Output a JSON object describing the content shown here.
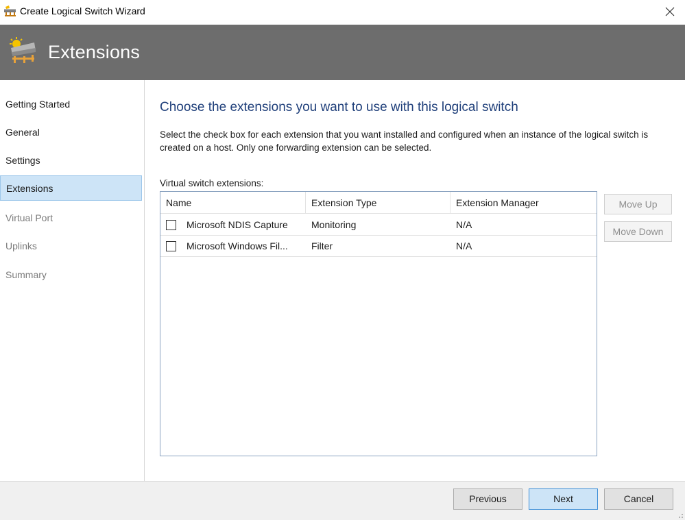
{
  "window": {
    "title": "Create Logical Switch Wizard",
    "close_icon": "close-icon"
  },
  "header": {
    "title": "Extensions",
    "icon": "logical-switch-icon"
  },
  "nav": {
    "items": [
      {
        "label": "Getting Started",
        "state": "done"
      },
      {
        "label": "General",
        "state": "done"
      },
      {
        "label": "Settings",
        "state": "done"
      },
      {
        "label": "Extensions",
        "state": "active"
      },
      {
        "label": "Virtual Port",
        "state": "disabled"
      },
      {
        "label": "Uplinks",
        "state": "disabled"
      },
      {
        "label": "Summary",
        "state": "disabled"
      }
    ]
  },
  "main": {
    "heading": "Choose the extensions you want to use with this logical switch",
    "description": "Select the check box for each extension that you want installed and configured when an instance of the logical switch is created on a host. Only one forwarding extension can be selected.",
    "list_label": "Virtual switch extensions:",
    "table": {
      "columns": [
        "Name",
        "Extension Type",
        "Extension Manager"
      ],
      "rows": [
        {
          "name": "Microsoft NDIS Capture",
          "type": "Monitoring",
          "manager": "N/A",
          "checked": false
        },
        {
          "name": "Microsoft Windows Fil...",
          "type": "Filter",
          "manager": "N/A",
          "checked": false
        }
      ]
    },
    "move_up": "Move Up",
    "move_down": "Move Down"
  },
  "footer": {
    "previous": "Previous",
    "next": "Next",
    "cancel": "Cancel"
  },
  "colors": {
    "header_band": "#6d6d6d",
    "heading_text": "#1f3f7a",
    "selection": "#cde4f7",
    "primary_border": "#3c8ed8"
  }
}
